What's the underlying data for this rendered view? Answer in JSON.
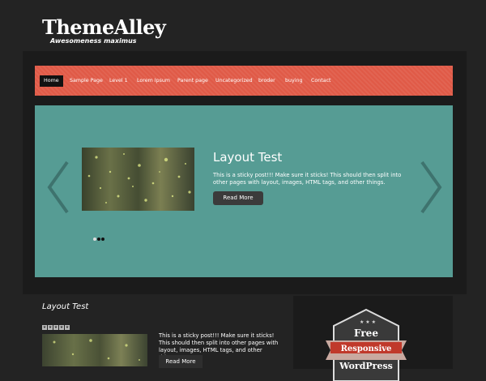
{
  "site": {
    "title": "ThemeAlley",
    "tagline": "Awesomeness maximus"
  },
  "nav": {
    "items": [
      {
        "label": "Home",
        "active": true
      },
      {
        "label": "Sample Page"
      },
      {
        "label": "Level 1"
      },
      {
        "label": "Lorem Ipsum"
      },
      {
        "label": "Parent page"
      },
      {
        "label": "Uncategorized"
      },
      {
        "label": "broder"
      },
      {
        "label": "buying"
      },
      {
        "label": "Contact"
      }
    ]
  },
  "slider": {
    "title": "Layout Test",
    "text": "This is a sticky post!!! Make sure it sticks! This should then split into other pages with layout, images, HTML tags, and other things.",
    "button": "Read More",
    "prev_icon": "chevron-left-icon",
    "next_icon": "chevron-right-icon",
    "dots": 3,
    "active_dot": 1
  },
  "post": {
    "title": "Layout Test",
    "rating_stars": 5,
    "text": "This is a sticky post!!! Make sure it sticks! This should then split into other pages with layout, images, HTML tags, and other things.",
    "button": "Read More"
  },
  "sidebar": {
    "badge_line1": "Free",
    "badge_line2": "Responsive",
    "badge_line3": "WordPress"
  },
  "colors": {
    "nav_bg": "#e05a47",
    "slider_bg": "#569c94",
    "page_bg": "#232323"
  }
}
